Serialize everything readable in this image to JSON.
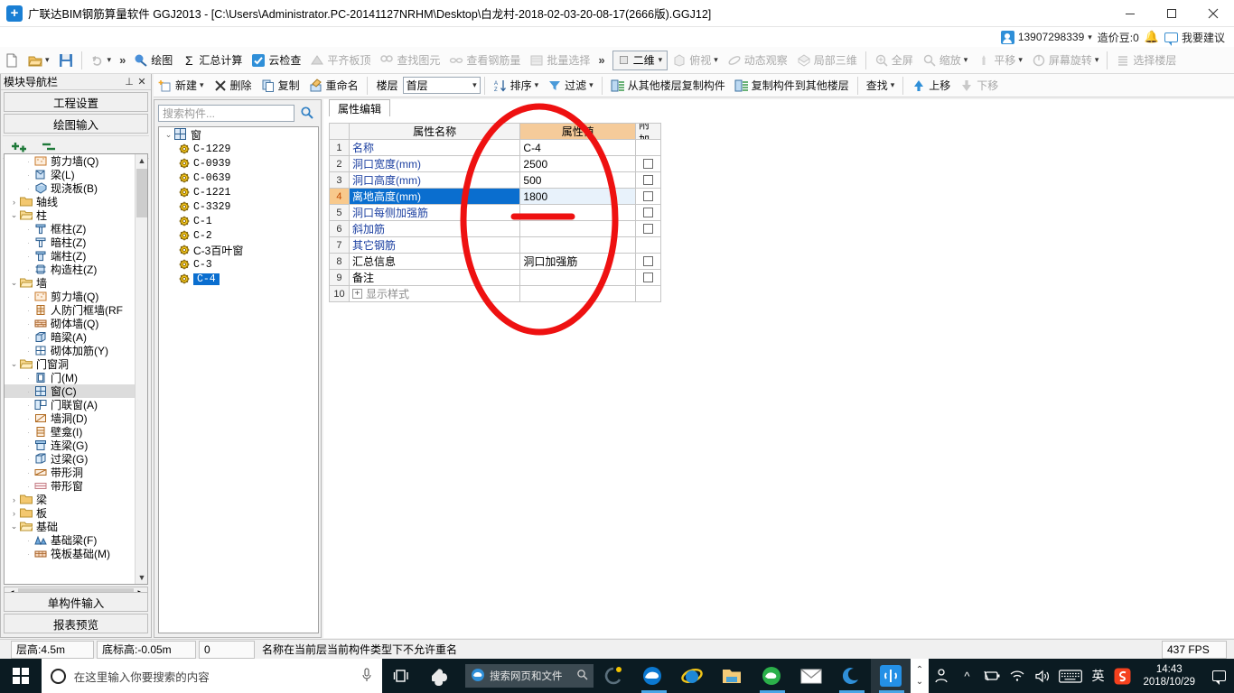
{
  "window": {
    "title": "广联达BIM钢筋算量软件 GGJ2013 - [C:\\Users\\Administrator.PC-20141127NRHM\\Desktop\\白龙村-2018-02-03-20-08-17(2666版).GGJ12]",
    "minimize": "—",
    "maximize": "❐",
    "close": "✕"
  },
  "account": {
    "phone": "13907298339",
    "caret": "▾",
    "points_label": "造价豆:0",
    "suggest_label": "我要建议"
  },
  "toolbar_main": {
    "new_icon": "new-file-icon",
    "open_icon": "open-folder-icon",
    "save_icon": "save-icon",
    "undo_icon": "undo-icon",
    "overflow": "»",
    "buttons": [
      {
        "label": "绘图",
        "icon": "draw-icon",
        "enabled": true
      },
      {
        "label": "汇总计算",
        "icon": "sigma-icon",
        "enabled": true
      },
      {
        "label": "云检查",
        "icon": "cloud-check-icon",
        "enabled": true
      },
      {
        "label": "平齐板顶",
        "icon": "align-slab-icon",
        "enabled": false
      },
      {
        "label": "查找图元",
        "icon": "find-element-icon",
        "enabled": false
      },
      {
        "label": "查看钢筋量",
        "icon": "view-rebar-icon",
        "enabled": false
      },
      {
        "label": "批量选择",
        "icon": "batch-select-icon",
        "enabled": false
      }
    ],
    "view_mode": "二维",
    "view_buttons": [
      {
        "label": "俯视",
        "icon": "top-view-icon",
        "enabled": false,
        "dropdown": true
      },
      {
        "label": "动态观察",
        "icon": "orbit-icon",
        "enabled": false,
        "dropdown": false
      },
      {
        "label": "局部三维",
        "icon": "local-3d-icon",
        "enabled": false,
        "dropdown": false
      },
      {
        "label": "全屏",
        "icon": "fullscreen-icon",
        "enabled": false,
        "dropdown": false
      },
      {
        "label": "缩放",
        "icon": "zoom-icon",
        "enabled": false,
        "dropdown": true
      },
      {
        "label": "平移",
        "icon": "pan-icon",
        "enabled": false,
        "dropdown": true
      },
      {
        "label": "屏幕旋转",
        "icon": "screen-rotate-icon",
        "enabled": false,
        "dropdown": true
      },
      {
        "label": "选择楼层",
        "icon": "select-floor-icon",
        "enabled": false,
        "dropdown": false
      }
    ],
    "right_overflow": "»"
  },
  "toolbar_component": {
    "new_label": "新建",
    "delete_label": "删除",
    "copy_label": "复制",
    "rename_label": "重命名",
    "floor_label": "楼层",
    "floor_value": "首层",
    "sort_label": "排序",
    "filter_label": "过滤",
    "copy_from_other_floor": "从其他楼层复制构件",
    "copy_to_other_floor": "复制构件到其他楼层",
    "find_label": "查找",
    "move_up_label": "上移",
    "move_down_label": "下移"
  },
  "module_panel": {
    "title": "模块导航栏",
    "pin_icon": "pin-icon",
    "close_icon": "close-icon",
    "buttons_top": [
      "工程设置",
      "绘图输入"
    ],
    "buttons_bottom": [
      "单构件输入",
      "报表预览"
    ],
    "expand_all_icon": "expand-all-icon",
    "collapse_all_icon": "collapse-all-icon",
    "tree": [
      {
        "label": "剪力墙(Q)",
        "depth": 2,
        "icon": "shear-wall-icon",
        "twisty": ""
      },
      {
        "label": "梁(L)",
        "depth": 2,
        "icon": "beam-icon",
        "twisty": ""
      },
      {
        "label": "现浇板(B)",
        "depth": 2,
        "icon": "slab-icon",
        "twisty": ""
      },
      {
        "label": "轴线",
        "depth": 1,
        "icon": "folder-icon",
        "twisty": "collapsed"
      },
      {
        "label": "柱",
        "depth": 1,
        "icon": "folder-open-icon",
        "twisty": "expanded"
      },
      {
        "label": "框柱(Z)",
        "depth": 2,
        "icon": "frame-column-icon",
        "twisty": ""
      },
      {
        "label": "暗柱(Z)",
        "depth": 2,
        "icon": "hidden-column-icon",
        "twisty": ""
      },
      {
        "label": "端柱(Z)",
        "depth": 2,
        "icon": "end-column-icon",
        "twisty": ""
      },
      {
        "label": "构造柱(Z)",
        "depth": 2,
        "icon": "structural-column-icon",
        "twisty": ""
      },
      {
        "label": "墙",
        "depth": 1,
        "icon": "folder-open-icon",
        "twisty": "expanded"
      },
      {
        "label": "剪力墙(Q)",
        "depth": 2,
        "icon": "shear-wall-icon",
        "twisty": ""
      },
      {
        "label": "人防门框墙(RF",
        "depth": 2,
        "icon": "defense-door-wall-icon",
        "twisty": ""
      },
      {
        "label": "砌体墙(Q)",
        "depth": 2,
        "icon": "masonry-wall-icon",
        "twisty": ""
      },
      {
        "label": "暗梁(A)",
        "depth": 2,
        "icon": "hidden-beam-icon",
        "twisty": ""
      },
      {
        "label": "砌体加筋(Y)",
        "depth": 2,
        "icon": "masonry-rebar-icon",
        "twisty": ""
      },
      {
        "label": "门窗洞",
        "depth": 1,
        "icon": "folder-open-icon",
        "twisty": "expanded"
      },
      {
        "label": "门(M)",
        "depth": 2,
        "icon": "door-icon",
        "twisty": ""
      },
      {
        "label": "窗(C)",
        "depth": 2,
        "icon": "window-icon",
        "twisty": "",
        "selected": true
      },
      {
        "label": "门联窗(A)",
        "depth": 2,
        "icon": "door-window-icon",
        "twisty": ""
      },
      {
        "label": "墙洞(D)",
        "depth": 2,
        "icon": "wall-hole-icon",
        "twisty": ""
      },
      {
        "label": "壁龛(I)",
        "depth": 2,
        "icon": "niche-icon",
        "twisty": ""
      },
      {
        "label": "连梁(G)",
        "depth": 2,
        "icon": "coupling-beam-icon",
        "twisty": ""
      },
      {
        "label": "过梁(G)",
        "depth": 2,
        "icon": "lintel-icon",
        "twisty": ""
      },
      {
        "label": "带形洞",
        "depth": 2,
        "icon": "strip-hole-icon",
        "twisty": ""
      },
      {
        "label": "带形窗",
        "depth": 2,
        "icon": "strip-window-icon",
        "twisty": ""
      },
      {
        "label": "梁",
        "depth": 1,
        "icon": "folder-icon",
        "twisty": "collapsed"
      },
      {
        "label": "板",
        "depth": 1,
        "icon": "folder-icon",
        "twisty": "collapsed"
      },
      {
        "label": "基础",
        "depth": 1,
        "icon": "folder-open-icon",
        "twisty": "expanded"
      },
      {
        "label": "基础梁(F)",
        "depth": 2,
        "icon": "foundation-beam-icon",
        "twisty": ""
      },
      {
        "label": "筏板基础(M)",
        "depth": 2,
        "icon": "raft-foundation-icon",
        "twisty": ""
      }
    ]
  },
  "component_panel": {
    "search_placeholder": "搜索构件...",
    "search_icon": "search-icon",
    "root": {
      "label": "窗",
      "icon": "window-icon",
      "twisty": "expanded"
    },
    "items": [
      {
        "label": "C-1229",
        "mono": true
      },
      {
        "label": "C-0939",
        "mono": true
      },
      {
        "label": "C-0639",
        "mono": true
      },
      {
        "label": "C-1221",
        "mono": true
      },
      {
        "label": "C-3329",
        "mono": true
      },
      {
        "label": "C-1",
        "mono": true
      },
      {
        "label": "C-2",
        "mono": true
      },
      {
        "label": "C-3百叶窗",
        "mono": false
      },
      {
        "label": "C-3",
        "mono": true
      },
      {
        "label": "C-4",
        "mono": true,
        "selected": true
      }
    ]
  },
  "properties": {
    "tab_label": "属性编辑",
    "headers": {
      "num": "",
      "name": "属性名称",
      "value": "属性值",
      "append": "附加"
    },
    "rows": [
      {
        "num": "1",
        "name": "名称",
        "value": "C-4",
        "blue": true,
        "checkbox": false
      },
      {
        "num": "2",
        "name": "洞口宽度(mm)",
        "value": "2500",
        "blue": true,
        "checkbox": true
      },
      {
        "num": "3",
        "name": "洞口高度(mm)",
        "value": "500",
        "blue": true,
        "checkbox": true
      },
      {
        "num": "4",
        "name": "离地高度(mm)",
        "value": "1800",
        "blue": true,
        "checkbox": true,
        "selected": true
      },
      {
        "num": "5",
        "name": "洞口每侧加强筋",
        "value": "",
        "blue": true,
        "checkbox": true
      },
      {
        "num": "6",
        "name": "斜加筋",
        "value": "",
        "blue": true,
        "checkbox": true
      },
      {
        "num": "7",
        "name": "其它钢筋",
        "value": "",
        "blue": true,
        "checkbox": false
      },
      {
        "num": "8",
        "name": "汇总信息",
        "value": "洞口加强筋",
        "blue": false,
        "checkbox": true
      },
      {
        "num": "9",
        "name": "备注",
        "value": "",
        "blue": false,
        "checkbox": true
      },
      {
        "num": "10",
        "name": "显示样式",
        "value": "",
        "blue": false,
        "checkbox": false,
        "expander": "+",
        "gray": true
      }
    ]
  },
  "annotation": {
    "ellipse_color": "#ee1111",
    "strike_color": "#ee1111"
  },
  "status_bar": {
    "floor_height": "层高:4.5m",
    "base_elevation": "底标高:-0.05m",
    "zero": "0",
    "message": "名称在当前层当前构件类型下不允许重名",
    "fps": "437 FPS"
  },
  "taskbar": {
    "start_icon": "windows-start-icon",
    "cortana_icon": "cortana-icon",
    "search_placeholder": "在这里输入你要搜索的内容",
    "mic_icon": "microphone-icon",
    "taskview_icon": "task-view-icon",
    "apps": [
      {
        "name": "skype-icon"
      },
      {
        "name": "edge-search-box",
        "label": "搜索网页和文件"
      },
      {
        "name": "chrome-notify-icon"
      },
      {
        "name": "edge-icon"
      },
      {
        "name": "internet-explorer-icon"
      },
      {
        "name": "file-explorer-icon"
      },
      {
        "name": "360-browser-icon"
      },
      {
        "name": "mail-icon"
      },
      {
        "name": "glodon-cloud-icon"
      },
      {
        "name": "ggj-app-icon"
      }
    ],
    "tray": {
      "show_hidden": "^",
      "people_icon": "people-icon",
      "chevron_up": "^",
      "battery_icon": "battery-icon",
      "wifi_icon": "wifi-icon",
      "volume_icon": "volume-icon",
      "keyboard_icon": "keyboard-icon",
      "ime_label": "英",
      "sogou_icon": "sogou-icon",
      "time": "14:43",
      "date": "2018/10/29",
      "action_center_icon": "action-center-icon"
    }
  }
}
